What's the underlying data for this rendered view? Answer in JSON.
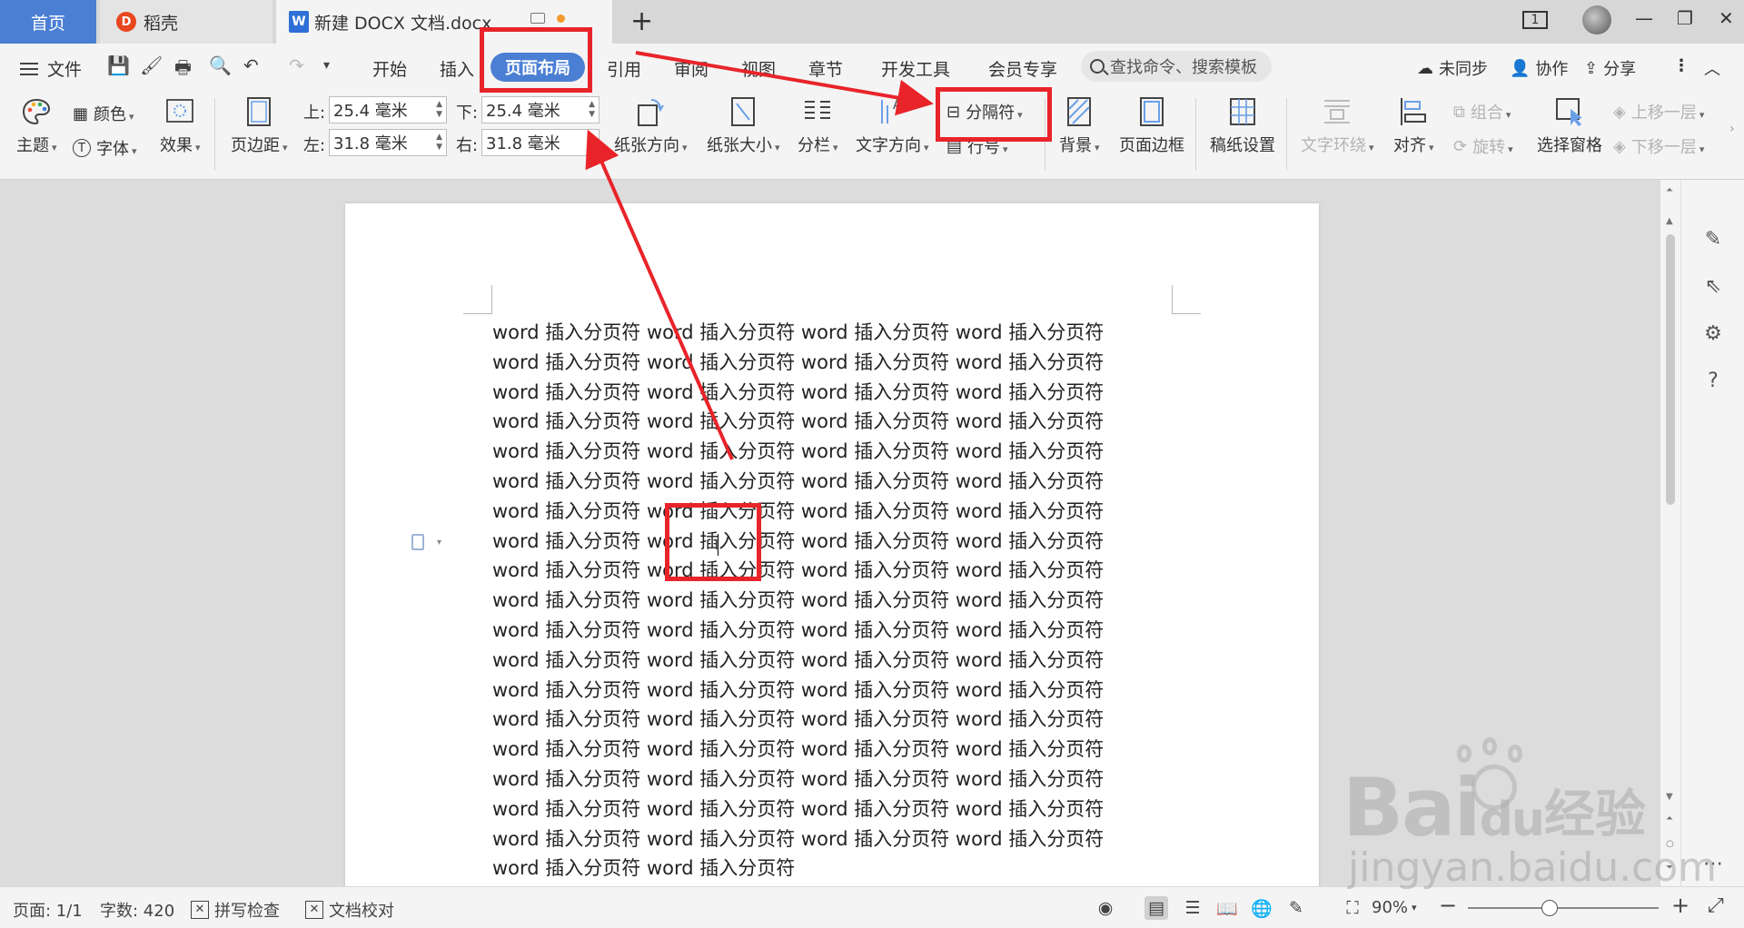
{
  "tabs": {
    "home": "首页",
    "daoke": "稻壳",
    "document": "新建 DOCX 文档.docx",
    "window_count": "1"
  },
  "menu": {
    "file": "文件",
    "items": [
      "开始",
      "插入",
      "页面布局",
      "引用",
      "审阅",
      "视图",
      "章节",
      "开发工具",
      "会员专享"
    ],
    "search_placeholder": "查找命令、搜索模板",
    "sync": "未同步",
    "collab": "协作",
    "share": "分享"
  },
  "ribbon": {
    "theme": "主题",
    "color": "颜色",
    "font": "字体",
    "effect": "效果",
    "margins": "页边距",
    "top_label": "上:",
    "bottom_label": "下:",
    "left_label": "左:",
    "right_label": "右:",
    "top_value": "25.4 毫米",
    "bottom_value": "25.4 毫米",
    "left_value": "31.8 毫米",
    "right_value": "31.8 毫米",
    "orientation": "纸张方向",
    "size": "纸张大小",
    "columns": "分栏",
    "text_direction": "文字方向",
    "separator": "分隔符",
    "line_number": "行号",
    "background": "背景",
    "page_border": "页面边框",
    "manuscript": "稿纸设置",
    "wrap": "文字环绕",
    "align": "对齐",
    "group": "组合",
    "rotate": "旋转",
    "select_pane": "选择窗格",
    "bring_forward": "上移一层",
    "send_backward": "下移一层"
  },
  "document": {
    "full_line": "word 插入分页符 word 插入分页符 word 插入分页符 word 插入分页符",
    "last_line": "word 插入分页符 word 插入分页符"
  },
  "status": {
    "page": "页面: 1/1",
    "words": "字数: 420",
    "spell": "拼写检查",
    "proof": "文档校对",
    "zoom": "90%"
  },
  "watermark": {
    "brand": "Bai",
    "brand_du": "du",
    "cn": "经验",
    "url": "jingyan.baidu.com"
  },
  "colors": {
    "accent": "#4b7fd4",
    "annotation": "#e8242a"
  }
}
